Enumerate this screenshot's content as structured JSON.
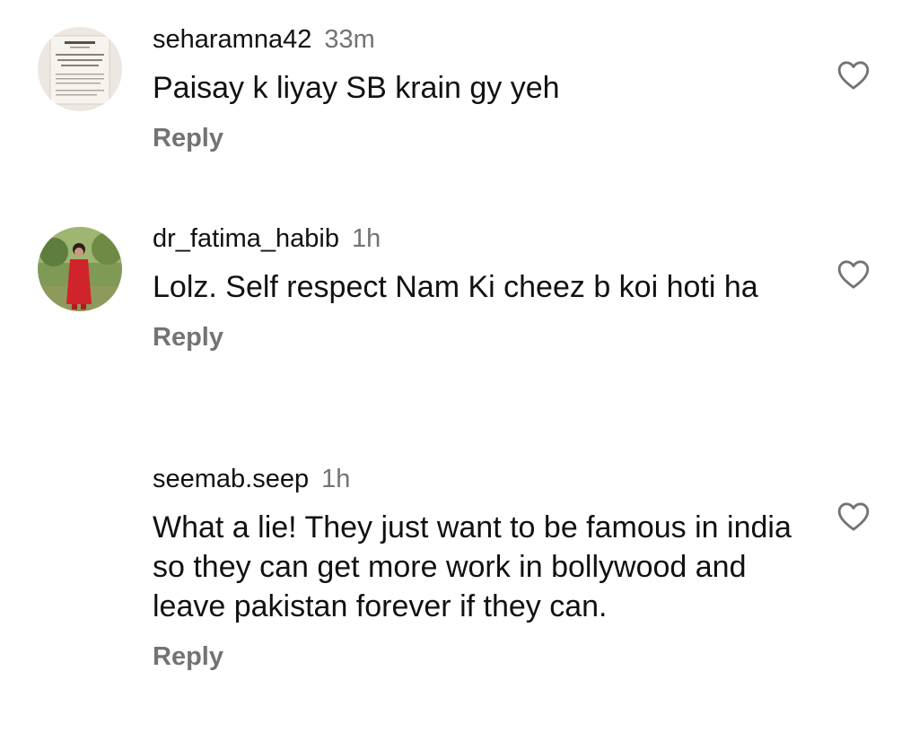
{
  "comments": [
    {
      "username": "seharamna42",
      "time": "33m",
      "text": "Paisay k liyay SB krain gy yeh",
      "reply_label": "Reply",
      "avatar_icon": "eid-takbeer-card-avatar",
      "avatar_caption": "EID TAKBEER",
      "like_icon": "heart-outline-icon"
    },
    {
      "username": "dr_fatima_habib",
      "time": "1h",
      "text": "Lolz. Self respect Nam Ki cheez b koi hoti ha",
      "reply_label": "Reply",
      "avatar_icon": "woman-red-dress-avatar",
      "like_icon": "heart-outline-icon"
    },
    {
      "username": "seemab.seep",
      "time": "1h",
      "text": "What a lie! They just want to be famous in india so they can get more work in bollywood and leave pakistan forever if they can.",
      "reply_label": "Reply",
      "like_icon": "heart-outline-icon"
    }
  ],
  "colors": {
    "text": "#111111",
    "secondary": "#737373",
    "background": "#ffffff"
  }
}
